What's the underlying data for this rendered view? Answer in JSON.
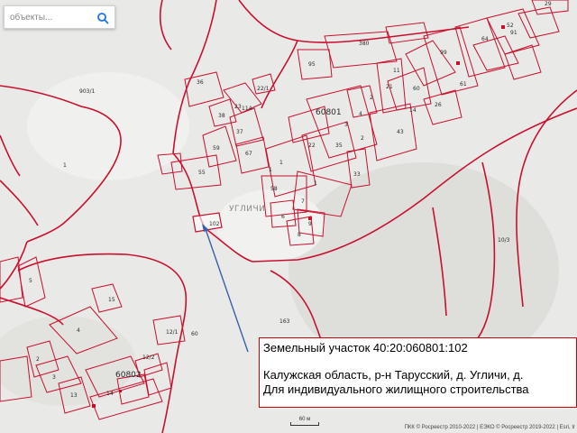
{
  "search": {
    "placeholder": "объекты..."
  },
  "blocks": [
    "60801",
    "60802"
  ],
  "settlement": "УГЛИЧИ",
  "parcels": [
    "903/1",
    "1",
    "5",
    "15",
    "4",
    "2",
    "3",
    "12/2",
    "12/1",
    "13",
    "14",
    "60",
    "10/3",
    "163",
    "102",
    "55",
    "59",
    "67",
    "37",
    "38",
    "114",
    "36",
    "23",
    "1",
    "22",
    "35",
    "33",
    "58",
    "1",
    "6",
    "8",
    "9",
    "380",
    "95",
    "21",
    "99",
    "64",
    "91",
    "29",
    "52",
    "61",
    "60",
    "26",
    "43",
    "2",
    "4",
    "3",
    "22/1",
    "14",
    "11",
    "2",
    "7",
    "1"
  ],
  "info_box": {
    "title": "Земельный участок 40:20:060801:102",
    "address": "Калужская область, р-н Тарусский, д. Угличи, д.",
    "purpose": "Для индивидуального жилищного строительства"
  },
  "scale_label": "60 м",
  "attribution": "ПКК © Росреестр 2010-2022 | ЕЭКО © Росреестр 2019-2022 | Esri, Ir"
}
